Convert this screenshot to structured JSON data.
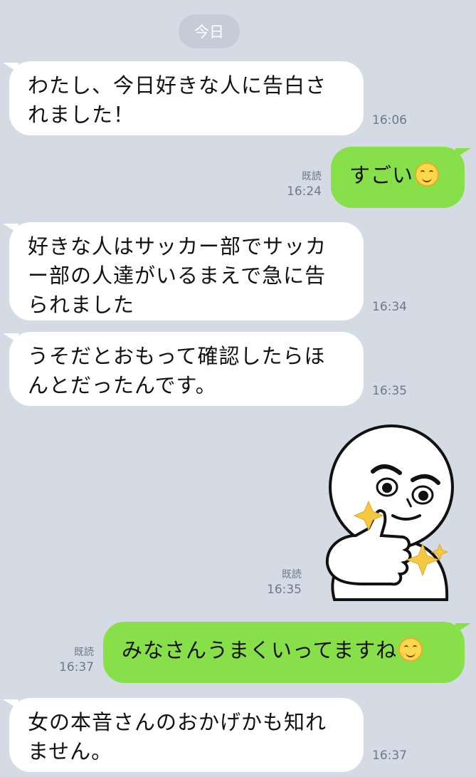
{
  "date_divider": "今日",
  "messages": [
    {
      "text": "わたし、今日好きな人に告白されました！",
      "time": "16:06"
    },
    {
      "text": "すごい",
      "time": "16:24",
      "read": "既読",
      "emoji": "smiling-face-icon"
    },
    {
      "text": "好きな人はサッカー部でサッカー部の人達がいるまえで急に告られました",
      "time": "16:34"
    },
    {
      "text": "うそだとおもって確認したらほんとだったんです。",
      "time": "16:35"
    },
    {
      "sticker": "thumbs-up-character-sticker",
      "time": "16:35",
      "read": "既読"
    },
    {
      "text": "みなさんうまくいってますね",
      "time": "16:37",
      "read": "既読",
      "emoji": "smiling-face-icon"
    },
    {
      "text": "女の本音さんのおかげかも知れません。",
      "time": "16:37"
    }
  ],
  "colors": {
    "background": "#d5dbe5",
    "incoming_bubble": "#ffffff",
    "outgoing_bubble": "#87e04a",
    "sparkle": "#f5c842"
  }
}
